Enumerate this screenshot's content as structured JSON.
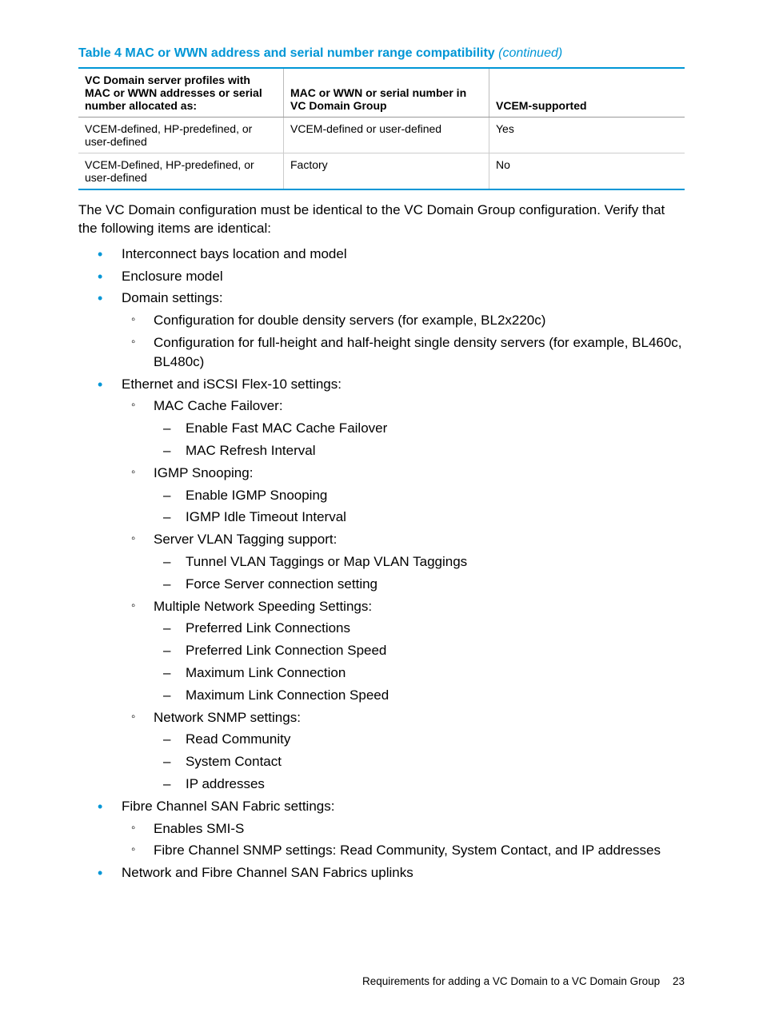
{
  "table": {
    "title_prefix": "Table 4 MAC or WWN address and serial number range compatibility ",
    "title_suffix": "(continued)",
    "headers": {
      "c1": "VC Domain server profiles with MAC or WWN addresses or serial number allocated as:",
      "c2": "MAC or WWN or serial number in VC Domain Group",
      "c3": "VCEM-supported"
    },
    "rows": [
      {
        "c1": "VCEM-defined, HP-predefined, or user-defined",
        "c2": "VCEM-defined or user-defined",
        "c3": "Yes"
      },
      {
        "c1": "VCEM-Defined, HP-predefined, or user-defined",
        "c2": "Factory",
        "c3": "No"
      }
    ]
  },
  "para1": "The VC Domain configuration must be identical to the VC Domain Group configuration. Verify that the following items are identical:",
  "l1": {
    "i0": "Interconnect bays location and model",
    "i1": "Enclosure model",
    "i2": "Domain settings:",
    "i2_sub": {
      "a": "Configuration for double density servers (for example, BL2x220c)",
      "b": "Configuration for full-height and half-height single density servers (for example, BL460c, BL480c)"
    },
    "i3": "Ethernet and iSCSI Flex-10 settings:",
    "i3_sub": {
      "a": "MAC Cache Failover:",
      "a1": "Enable Fast MAC Cache Failover",
      "a2": "MAC Refresh Interval",
      "b": "IGMP Snooping:",
      "b1": "Enable IGMP Snooping",
      "b2": "IGMP Idle Timeout Interval",
      "c": "Server VLAN Tagging support:",
      "c1": "Tunnel VLAN Taggings or Map VLAN Taggings",
      "c2": "Force Server connection setting",
      "d": "Multiple Network Speeding Settings:",
      "d1": "Preferred Link Connections",
      "d2": "Preferred Link Connection Speed",
      "d3": "Maximum Link Connection",
      "d4": "Maximum Link Connection Speed",
      "e": "Network SNMP settings:",
      "e1": "Read Community",
      "e2": "System Contact",
      "e3": "IP addresses"
    },
    "i4": "Fibre Channel SAN Fabric settings:",
    "i4_sub": {
      "a": "Enables SMI-S",
      "b": "Fibre Channel SNMP settings: Read Community, System Contact, and IP addresses"
    },
    "i5": "Network and Fibre Channel SAN Fabrics uplinks"
  },
  "footer": {
    "text": "Requirements for adding a VC Domain to a VC Domain Group",
    "page": "23"
  }
}
